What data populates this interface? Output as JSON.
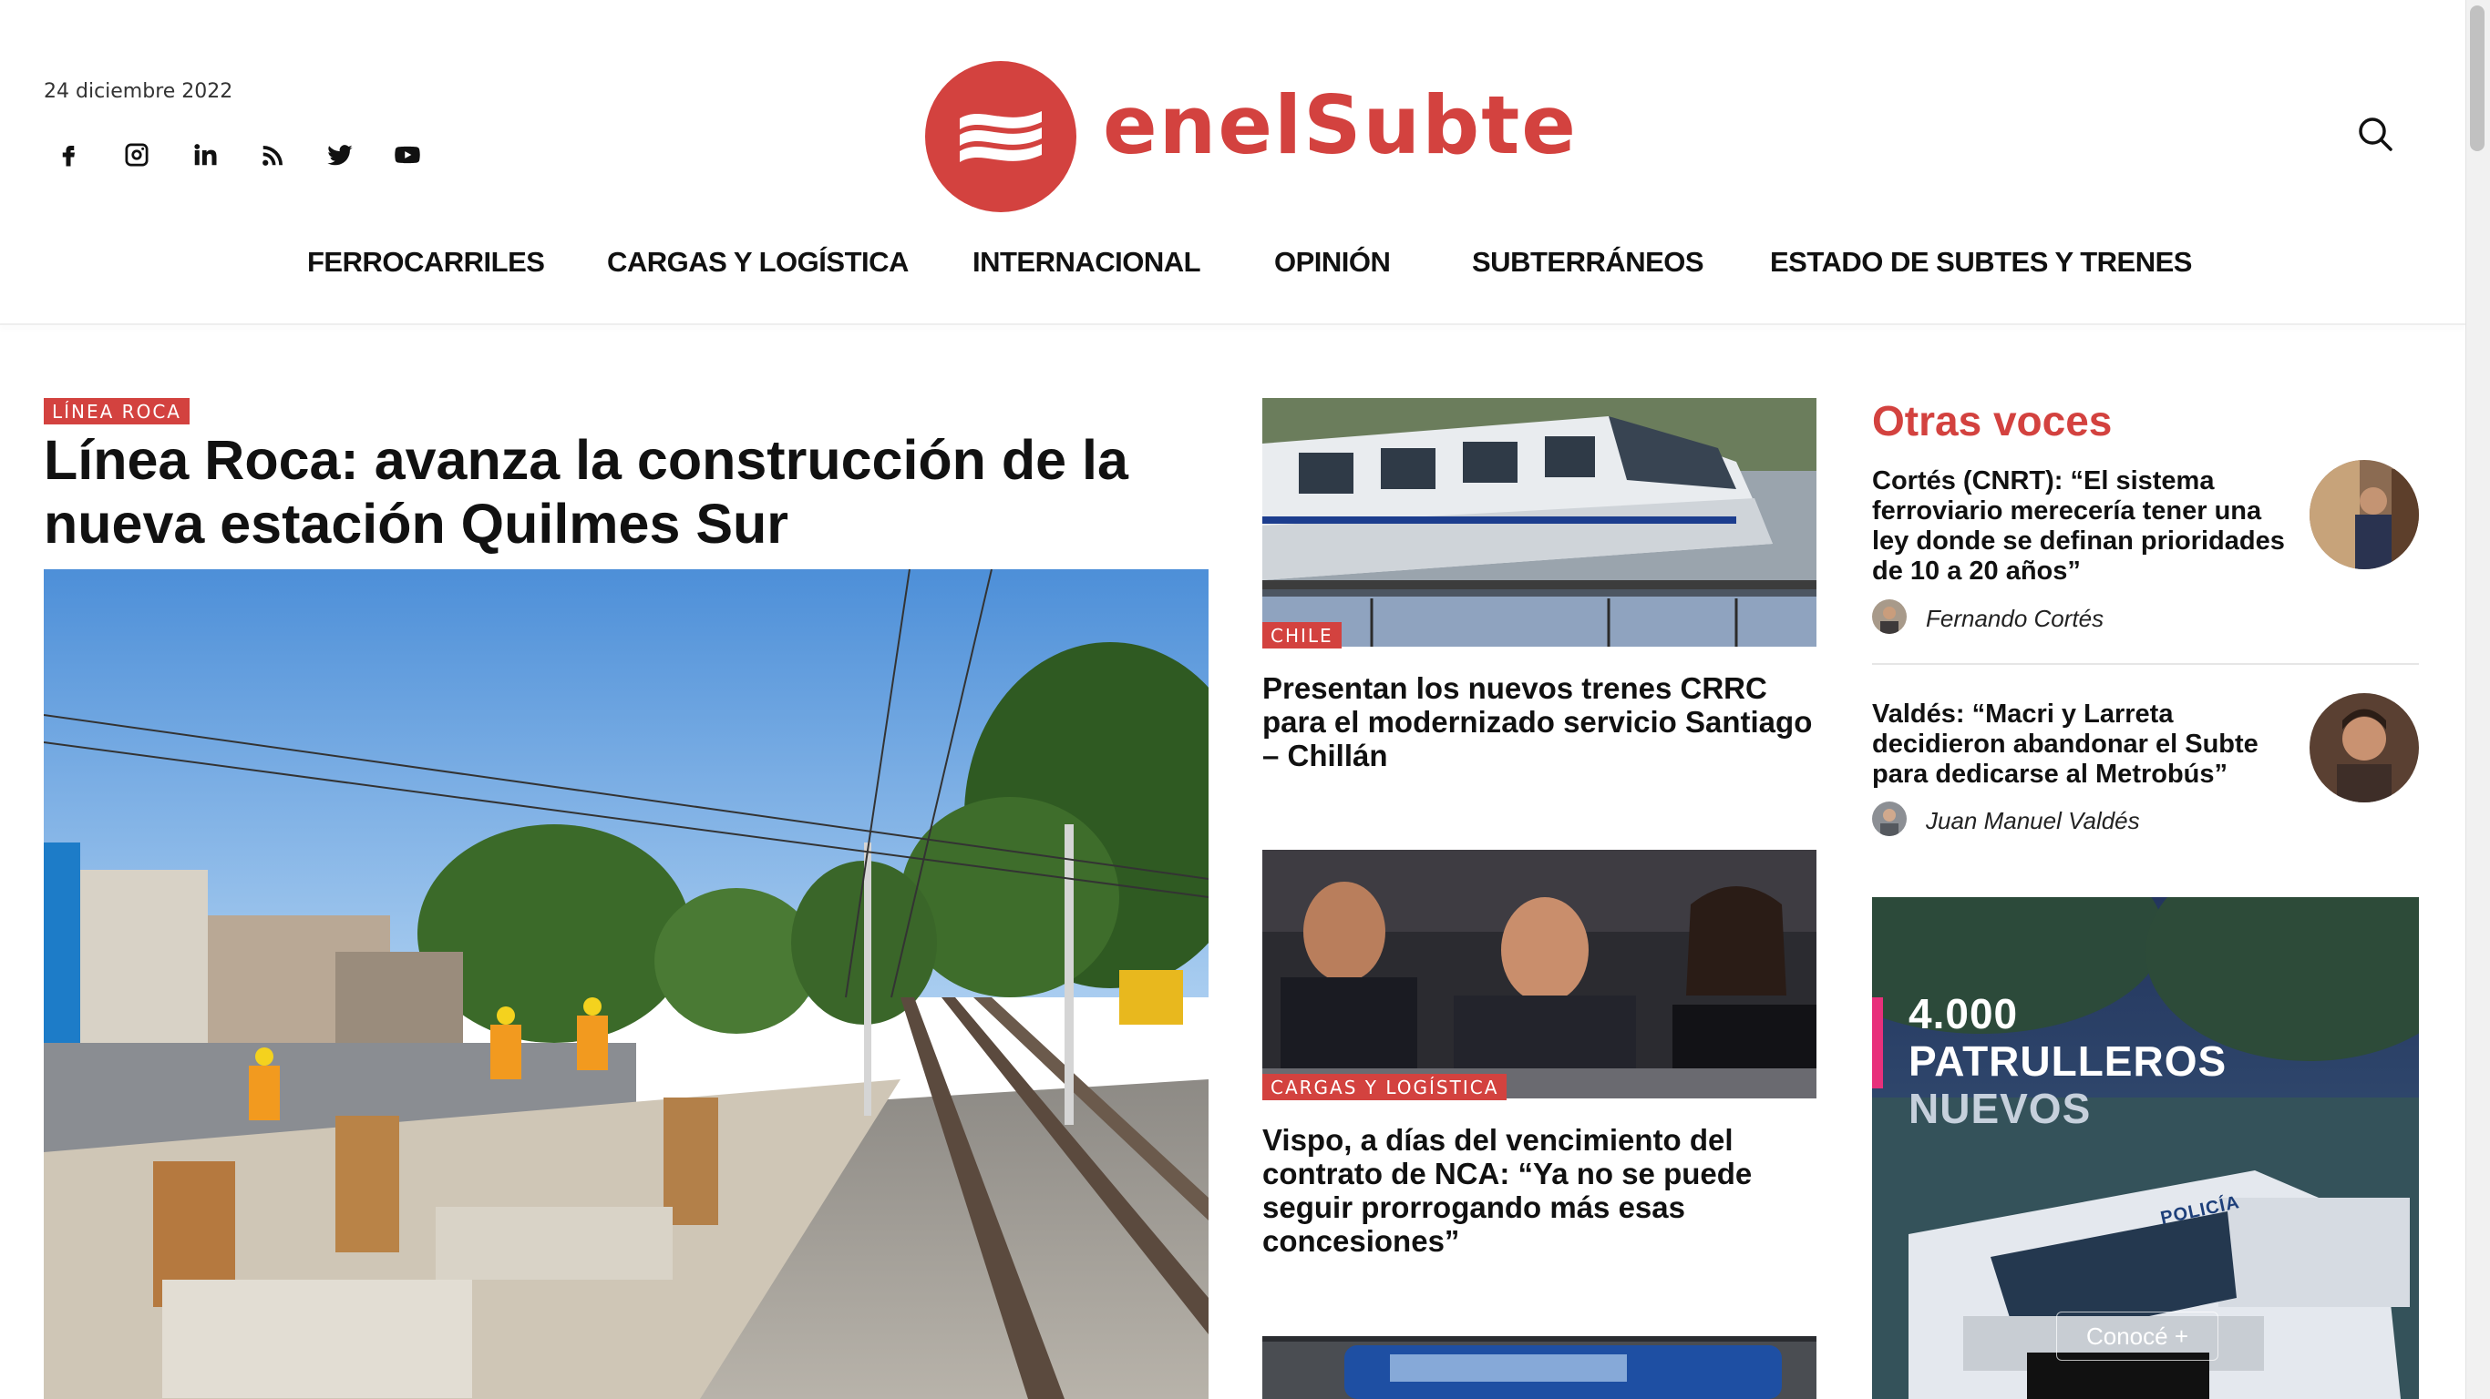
{
  "header": {
    "date": "24 diciembre 2022",
    "logo_text": "enelSubte",
    "brand_color": "#d3423f",
    "social_icons": [
      "facebook-icon",
      "instagram-icon",
      "linkedin-icon",
      "rss-icon",
      "twitter-icon",
      "youtube-icon"
    ]
  },
  "nav": {
    "items": [
      {
        "label": "FERROCARRILES"
      },
      {
        "label": "CARGAS Y LOGÍSTICA"
      },
      {
        "label": "INTERNACIONAL"
      },
      {
        "label": "OPINIÓN"
      },
      {
        "label": "SUBTERRÁNEOS"
      },
      {
        "label": "ESTADO DE SUBTES Y TRENES"
      }
    ]
  },
  "main_article": {
    "category": "LÍNEA ROCA",
    "title": "Línea Roca: avanza la construcción de la nueva estación Quilmes Sur"
  },
  "middle": {
    "articles": [
      {
        "category": "CHILE",
        "title": "Presentan los nuevos trenes CRRC para el modernizado servicio Santiago – Chillán"
      },
      {
        "category": "CARGAS Y LOGÍSTICA",
        "title": "Vispo, a días del vencimiento del contrato de NCA: “Ya no se puede seguir prorrogando más esas concesiones”"
      }
    ]
  },
  "otras_voces": {
    "heading": "Otras voces",
    "items": [
      {
        "title": "Cortés (CNRT): “El sistema ferroviario merecería tener una ley donde se definan prioridades de 10 a 20 años”",
        "author": "Fernando Cortés"
      },
      {
        "title": "Valdés: “Macri y Larreta decidieron abandonar el Subte para dedicarse al Metrobús”",
        "author": "Juan Manuel Valdés"
      }
    ]
  },
  "ad": {
    "line1": "4.000",
    "line2": "PATRULLEROS",
    "line3": "NUEVOS",
    "cta": "Conocé +",
    "vehicle_text": "POLICÍA"
  }
}
